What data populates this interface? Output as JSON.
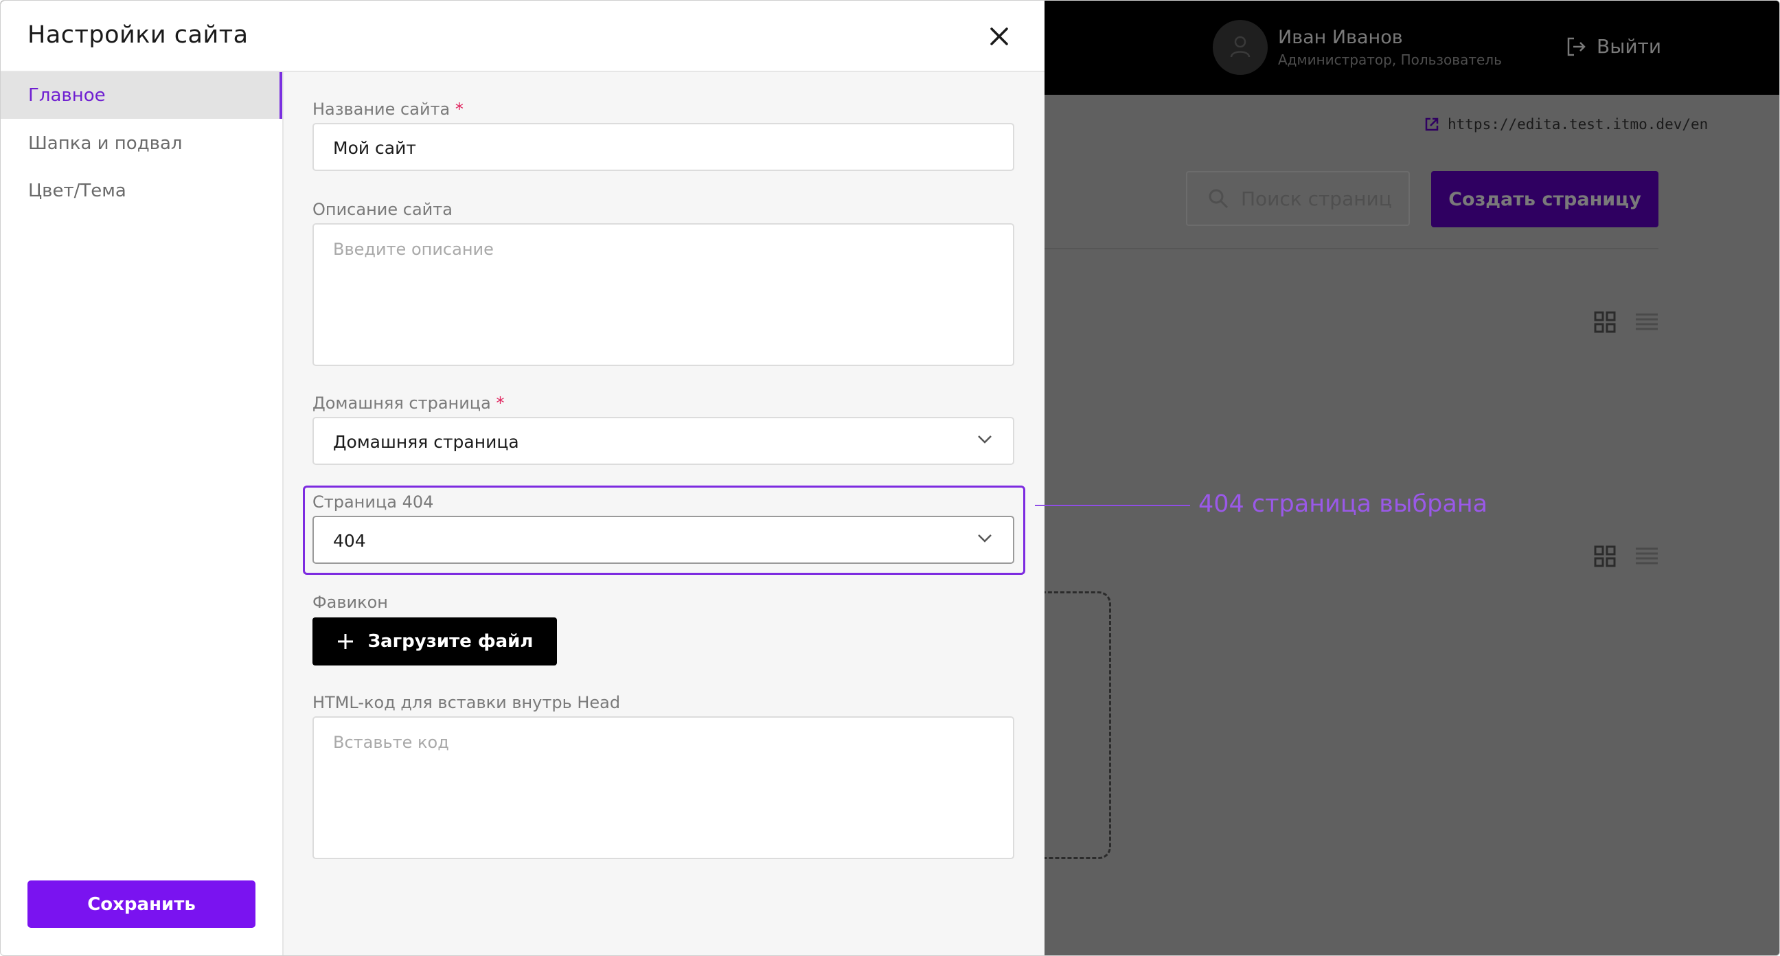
{
  "modal": {
    "title": "Настройки сайта",
    "close_icon": "close-icon"
  },
  "sidebar": {
    "items": [
      {
        "label": "Главное",
        "active": true
      },
      {
        "label": "Шапка и подвал",
        "active": false
      },
      {
        "label": "Цвет/Тема",
        "active": false
      }
    ],
    "save_label": "Сохранить"
  },
  "form": {
    "site_name": {
      "label": "Название сайта",
      "required_mark": "*",
      "value": "Мой сайт"
    },
    "site_description": {
      "label": "Описание сайта",
      "placeholder": "Введите описание",
      "value": ""
    },
    "home_page": {
      "label": "Домашняя страница",
      "required_mark": "*",
      "value": "Домашняя страница"
    },
    "page_404": {
      "label": "Страница 404",
      "value": "404"
    },
    "favicon": {
      "label": "Фавикон",
      "upload_label": "Загрузите файл"
    },
    "head_html": {
      "label": "HTML-код для вставки внутрь Head",
      "placeholder": "Вставьте код",
      "value": ""
    }
  },
  "annotation": {
    "text": "404 страница выбрана"
  },
  "background_app": {
    "user_name": "Иван Иванов",
    "user_role": "Администратор, Пользователь",
    "logout_label": "Выйти",
    "site_url": "https://edita.test.itmo.dev/en",
    "search_placeholder": "Поиск страниц",
    "create_page_label": "Создать страницу"
  },
  "colors": {
    "accent": "#7a13f0",
    "highlight": "#7d2be0",
    "annotation": "#9a59e8",
    "overlay": "#606060"
  }
}
